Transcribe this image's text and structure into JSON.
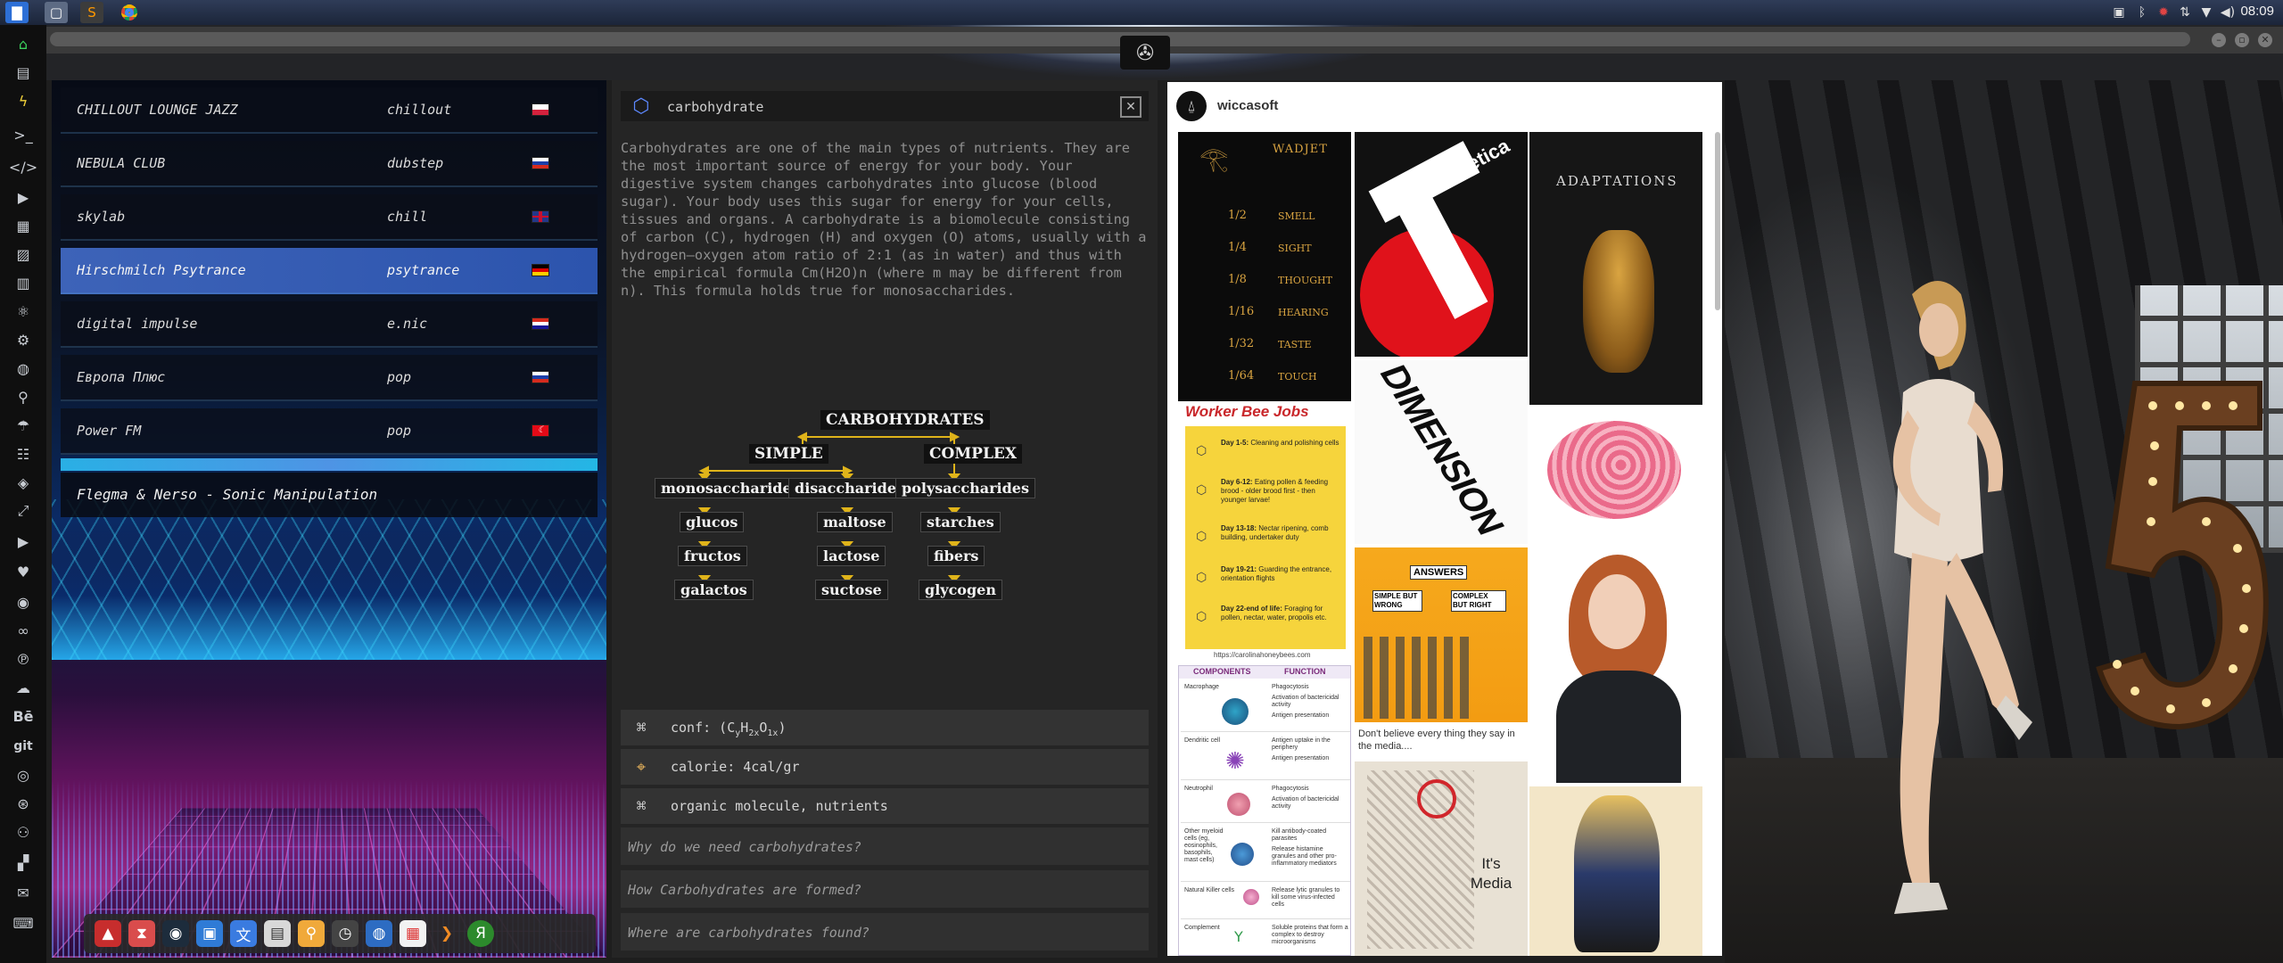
{
  "system": {
    "clock": "08:09"
  },
  "radio": {
    "stations": [
      {
        "name": "CHILLOUT LOUNGE JAZZ",
        "genre": "chillout",
        "flag": "poland"
      },
      {
        "name": "NEBULA CLUB",
        "genre": "dubstep",
        "flag": "russia"
      },
      {
        "name": "skylab",
        "genre": "chill",
        "flag": "uk"
      },
      {
        "name": "Hirschmilch Psytrance",
        "genre": "psytrance",
        "flag": "germany"
      },
      {
        "name": "digital impulse",
        "genre": "e.nic",
        "flag": "croatia"
      },
      {
        "name": "Европа Плюс",
        "genre": "pop",
        "flag": "russia"
      },
      {
        "name": "Power FM",
        "genre": "pop",
        "flag": "turkey"
      }
    ],
    "active_station_index": 3,
    "now_playing": "Flegma & Nerso - Sonic Manipulation"
  },
  "knowledge": {
    "title": "carbohydrate",
    "body": "Carbohydrates are one of the main types of nutrients. They are the most important source of energy for your body. Your digestive system changes carbohydrates into glucose (blood sugar). Your body uses this sugar for energy for your cells, tissues and organs. A carbohydrate is a biomolecule consisting of carbon (C), hydrogen (H) and oxygen (O) atoms, usually with a hydrogen–oxygen atom ratio of 2:1 (as in water) and thus with the empirical formula Cm(H2O)n (where m may be different from n). This formula holds true for monosaccharides.",
    "diagram": {
      "root": "CARBOHYDRATES",
      "branch_simple": "SIMPLE",
      "branch_complex": "COMPLEX",
      "col1": [
        "monosaccharide",
        "glucos",
        "fructos",
        "galactos"
      ],
      "col2": [
        "disaccharides",
        "maltose",
        "lactose",
        "suctose"
      ],
      "col3": [
        "polysaccharides",
        "starches",
        "fibers",
        "glycogen"
      ]
    },
    "facts": [
      {
        "icon": "molecule-icon",
        "text_prefix": "conf: (C",
        "sub1": "y",
        "mid1": "H",
        "sub2": "2x",
        "mid2": "O",
        "sub3": "1x",
        "text_suffix": ")"
      },
      {
        "icon": "map-pin-icon",
        "text": "calorie: 4cal/gr"
      },
      {
        "icon": "molecule-icon",
        "text": "organic molecule, nutrients"
      }
    ],
    "questions": [
      "Why do we need carbohydrates?",
      "How Carbohydrates are formed?",
      "Where are carbohydrates found?"
    ]
  },
  "board": {
    "username": "wiccasoft",
    "pins": {
      "wadjet_title": "WADJET",
      "wadjet_rows": [
        {
          "fraction": "1/2",
          "sense": "SMELL"
        },
        {
          "fraction": "1/4",
          "sense": "SIGHT"
        },
        {
          "fraction": "1/8",
          "sense": "THOUGHT"
        },
        {
          "fraction": "1/16",
          "sense": "HEARING"
        },
        {
          "fraction": "1/32",
          "sense": "TASTE"
        },
        {
          "fraction": "1/64",
          "sense": "TOUCH"
        }
      ],
      "helvetica_word": "elvetica",
      "adaptations_title": "ADAPTATIONS",
      "worker_bee_title": "Worker Bee Jobs",
      "worker_bee_days": [
        {
          "day": "Day 1-5:",
          "text": "Cleaning and polishing cells"
        },
        {
          "day": "Day 6-12:",
          "text": "Eating pollen & feeding brood - older brood first - then younger larvae!"
        },
        {
          "day": "Day 13-18:",
          "text": "Nectar ripening, comb building, undertaker duty"
        },
        {
          "day": "Day 19-21:",
          "text": "Guarding the entrance, orientation flights"
        },
        {
          "day": "Day 22-end of life:",
          "text": "Foraging for pollen, nectar, water, propolis etc."
        }
      ],
      "worker_bee_url": "https://carolinahoneybees.com",
      "dimension_word": "DIMENSION",
      "answers_caption": "Don't believe every thing they say in the media....",
      "answers_sign": "ANSWERS",
      "answers_simple": "SIMPLE BUT WRONG",
      "answers_complex": "COMPLEX BUT RIGHT",
      "immune_headers": [
        "COMPONENTS",
        "FUNCTION"
      ],
      "immune_rows": [
        {
          "component": "Macrophage",
          "functions": [
            "Phagocytosis",
            "Activation of bactericidal activity",
            "Antigen presentation"
          ]
        },
        {
          "component": "Dendritic cell",
          "functions": [
            "Antigen uptake in the periphery",
            "Antigen presentation"
          ]
        },
        {
          "component": "Neutrophil",
          "functions": [
            "Phagocytosis",
            "Activation of bactericidal activity"
          ]
        },
        {
          "component": "Other myeloid cells (eg, eosinophils, basophils, mast cells)",
          "functions": [
            "Kill antibody-coated parasites",
            "Release histamine granules and other pro-inflammatory mediators"
          ]
        },
        {
          "component": "Natural Killer cells",
          "functions": [
            "Release lytic granules to kill some virus-infected cells"
          ]
        },
        {
          "component": "Complement",
          "functions": [
            "Soluble proteins that form a complex to destroy microorganisms"
          ]
        }
      ],
      "its_media": "It's Media"
    }
  },
  "colors": {
    "active_station": "#3d63b8",
    "topic_icon": "#5d88ff",
    "board_bg": "#ffffff",
    "panel_bg": "#252525"
  }
}
